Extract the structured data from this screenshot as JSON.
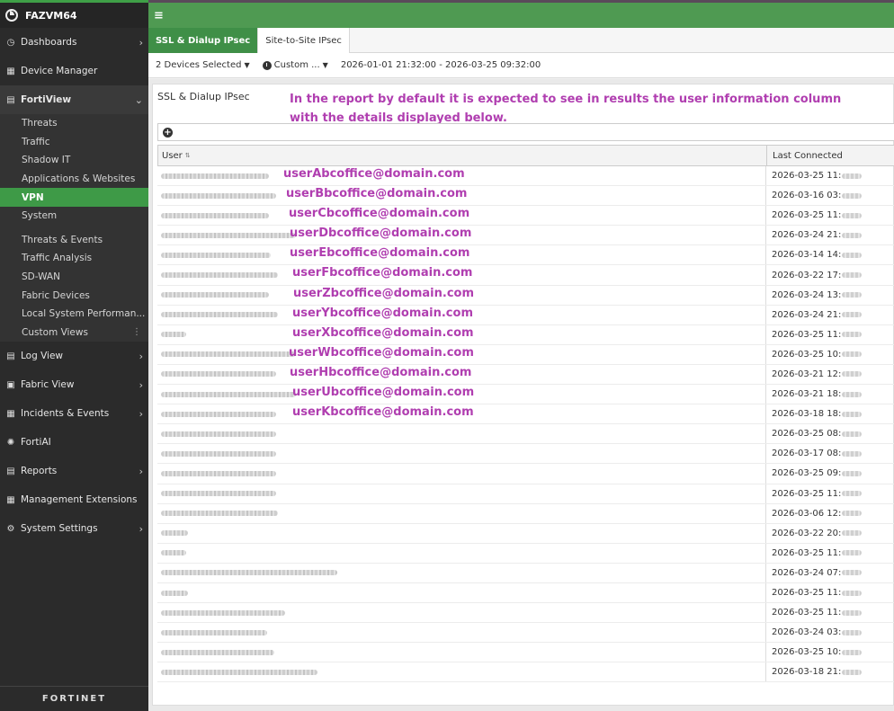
{
  "app": {
    "device_name": "FAZVM64",
    "brand": "FORTINET"
  },
  "sidebar": {
    "items": [
      {
        "label": "Dashboards",
        "icon": "dashboard-icon",
        "chevron": "›"
      },
      {
        "label": "Device Manager",
        "icon": "device-manager-icon",
        "chevron": ""
      },
      {
        "label": "FortiView",
        "icon": "fortiview-icon",
        "chevron": "⌄",
        "expanded": true
      },
      {
        "label": "Log View",
        "icon": "log-view-icon",
        "chevron": "›"
      },
      {
        "label": "Fabric View",
        "icon": "fabric-view-icon",
        "chevron": "›"
      },
      {
        "label": "Incidents & Events",
        "icon": "incidents-icon",
        "chevron": "›"
      },
      {
        "label": "FortiAI",
        "icon": "fortiai-icon",
        "chevron": ""
      },
      {
        "label": "Reports",
        "icon": "reports-icon",
        "chevron": "›"
      },
      {
        "label": "Management Extensions",
        "icon": "extensions-icon",
        "chevron": ""
      },
      {
        "label": "System Settings",
        "icon": "settings-gear-icon",
        "chevron": "›"
      }
    ],
    "fortiview_sub_group1": [
      "Threats",
      "Traffic",
      "Shadow IT",
      "Applications & Websites",
      "VPN",
      "System"
    ],
    "fortiview_sub_group2": [
      "Threats & Events",
      "Traffic Analysis",
      "SD-WAN",
      "Fabric Devices",
      "Local System Performan...",
      "Custom Views"
    ],
    "active_sub": "VPN"
  },
  "topbar": {
    "menu_glyph": "≡"
  },
  "tabs": [
    {
      "label": "SSL & Dialup IPsec",
      "active": true
    },
    {
      "label": "Site-to-Site IPsec",
      "active": false
    }
  ],
  "filters": {
    "devices": "2 Devices Selected",
    "time_mode": "Custom ...",
    "time_range": "2026-01-01 21:32:00 - 2026-03-25 09:32:00"
  },
  "panel": {
    "title": "SSL & Dialup IPsec",
    "annotation_line1": "In the report by default it is expected to see in results the user information column",
    "annotation_line2": "with the details displayed below."
  },
  "grid": {
    "columns": {
      "user": "User",
      "last_connected": "Last Connected"
    },
    "rows": [
      {
        "email": "userAbcoffice@domain.com",
        "last": "2026-03-25 11:"
      },
      {
        "email": "userBbcoffice@domain.com",
        "last": "2026-03-16 03:"
      },
      {
        "email": "userCbcoffice@domain.com",
        "last": "2026-03-25 11:"
      },
      {
        "email": "userDbcoffice@domain.com",
        "last": "2026-03-24 21:"
      },
      {
        "email": "userEbcoffice@domain.com",
        "last": "2026-03-14 14:"
      },
      {
        "email": "userFbcoffice@domain.com",
        "last": "2026-03-22 17:"
      },
      {
        "email": "userZbcoffice@domain.com",
        "last": "2026-03-24 13:"
      },
      {
        "email": "userYbcoffice@domain.com",
        "last": "2026-03-24 21:"
      },
      {
        "email": "userXbcoffice@domain.com",
        "last": "2026-03-25 11:"
      },
      {
        "email": "userWbcoffice@domain.com",
        "last": "2026-03-25 10:"
      },
      {
        "email": "userHbcoffice@domain.com",
        "last": "2026-03-21 12:"
      },
      {
        "email": "userUbcoffice@domain.com",
        "last": "2026-03-21 18:"
      },
      {
        "email": "userKbcoffice@domain.com",
        "last": "2026-03-18 18:"
      },
      {
        "email": "",
        "last": "2026-03-25 08:"
      },
      {
        "email": "",
        "last": "2026-03-17 08:"
      },
      {
        "email": "",
        "last": "2026-03-25 09:"
      },
      {
        "email": "",
        "last": "2026-03-25 11:"
      },
      {
        "email": "",
        "last": "2026-03-06 12:"
      },
      {
        "email": "",
        "last": "2026-03-22 20:"
      },
      {
        "email": "",
        "last": "2026-03-25 11:"
      },
      {
        "email": "",
        "last": "2026-03-24 07:"
      },
      {
        "email": "",
        "last": "2026-03-25 11:"
      },
      {
        "email": "",
        "last": "2026-03-25 11:"
      },
      {
        "email": "",
        "last": "2026-03-24 03:"
      },
      {
        "email": "",
        "last": "2026-03-25 10:"
      },
      {
        "email": "",
        "last": "2026-03-18 21:"
      }
    ]
  },
  "colors": {
    "accent_green": "#3f8f47",
    "annotation": "#b03eb0",
    "sidebar_bg": "#2b2b2b"
  }
}
